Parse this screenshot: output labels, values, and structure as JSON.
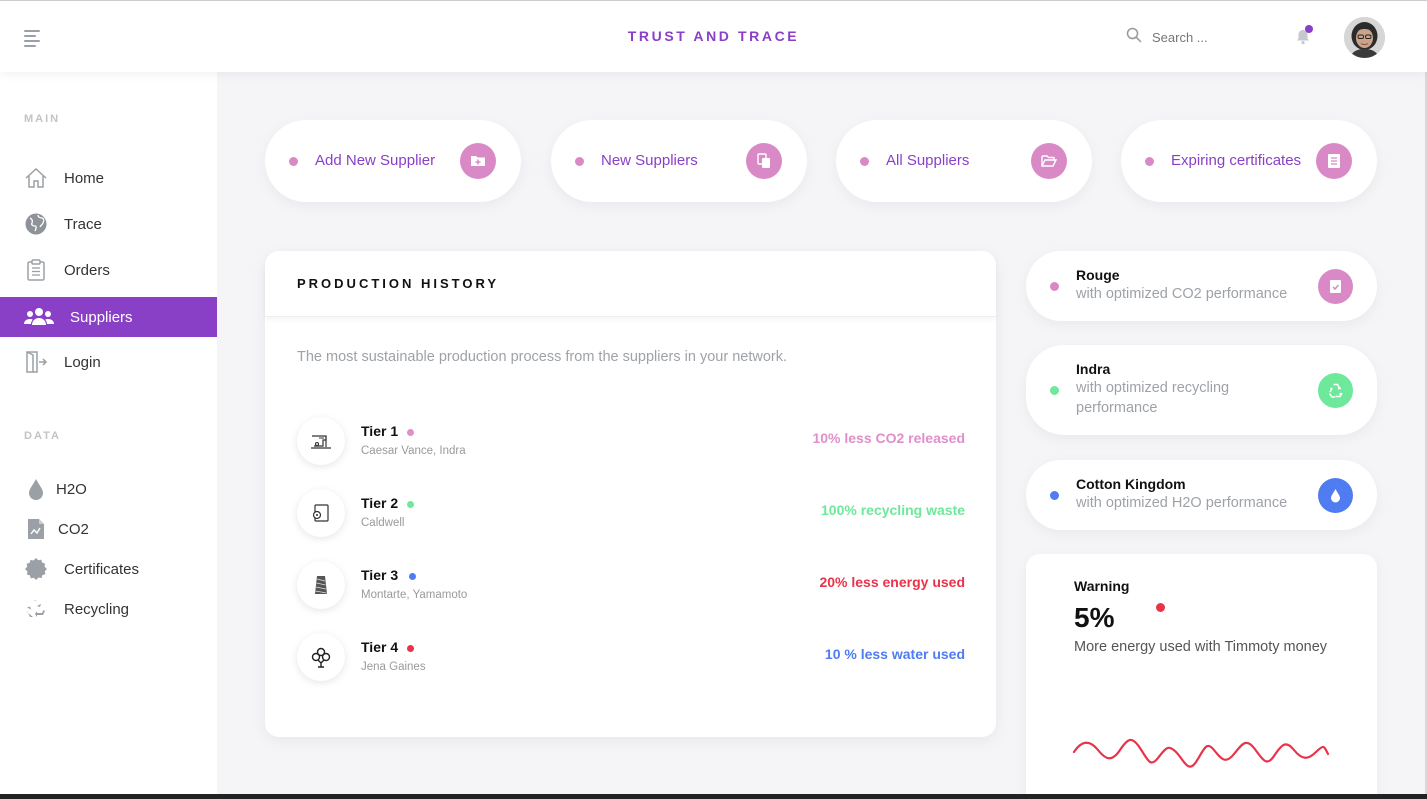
{
  "app": {
    "brand": "TRUST AND TRACE"
  },
  "header": {
    "search_placeholder": "Search ..."
  },
  "sidebar": {
    "main_section": "MAIN",
    "data_section": "DATA",
    "main_items": [
      {
        "label": "Home",
        "icon": "home-icon"
      },
      {
        "label": "Trace",
        "icon": "globe-icon"
      },
      {
        "label": "Orders",
        "icon": "clipboard-icon"
      },
      {
        "label": "Suppliers",
        "icon": "users-icon",
        "active": true
      },
      {
        "label": "Login",
        "icon": "door-icon"
      }
    ],
    "data_items": [
      {
        "label": "H2O",
        "icon": "water-drop-icon"
      },
      {
        "label": "CO2",
        "icon": "file-chart-icon"
      },
      {
        "label": "Certificates",
        "icon": "certificate-icon"
      },
      {
        "label": "Recycling",
        "icon": "recycle-icon"
      }
    ]
  },
  "quick_actions": [
    {
      "label": "Add New Supplier",
      "icon": "folder-plus-icon"
    },
    {
      "label": "New Suppliers",
      "icon": "copy-icon"
    },
    {
      "label": "All Suppliers",
      "icon": "folder-open-icon"
    },
    {
      "label": "Expiring certificates",
      "icon": "clipboard-list-icon"
    }
  ],
  "production_history": {
    "title": "PRODUCTION HISTORY",
    "subtitle": "The most sustainable production process from the suppliers in your network.",
    "tiers": [
      {
        "name": "Tier 1",
        "suppliers": "Caesar Vance, Indra",
        "metric": "10% less CO2 released",
        "color": "#e08fca",
        "icon": "sewing-machine-icon"
      },
      {
        "name": "Tier 2",
        "suppliers": "Caldwell",
        "metric": "100% recycling waste",
        "color": "#6ee89a",
        "icon": "fabric-roll-icon"
      },
      {
        "name": "Tier 3",
        "suppliers": "Montarte, Yamamoto",
        "metric": "20% less energy used",
        "color": "#e8334a",
        "dot_color": "#4f7cf0",
        "icon": "yarn-spool-icon"
      },
      {
        "name": "Tier 4",
        "suppliers": "Jena Gaines",
        "metric": "10 % less water used",
        "color": "#4f7cf0",
        "dot_color": "#e8334a",
        "icon": "cotton-flower-icon"
      }
    ]
  },
  "supplier_cards": [
    {
      "name": "Rouge",
      "desc": "with optimized CO2 performance",
      "color": "#d98ac6",
      "icon": "clipboard-check-icon"
    },
    {
      "name": "Indra",
      "desc": "with optimized recycling performance",
      "color": "#6ee89a",
      "icon": "recycle-icon"
    },
    {
      "name": "Cotton Kingdom",
      "desc": "with optimized H2O performance",
      "color": "#4f7cf0",
      "icon": "water-drop-icon"
    }
  ],
  "warning": {
    "title": "Warning",
    "value": "5%",
    "desc": "More energy used with Timmoty money",
    "color": "#e8334a"
  },
  "colors": {
    "accent": "#8a3fc7",
    "pink": "#d98ac6",
    "green": "#6ee89a",
    "blue": "#4f7cf0",
    "red": "#e8334a"
  }
}
